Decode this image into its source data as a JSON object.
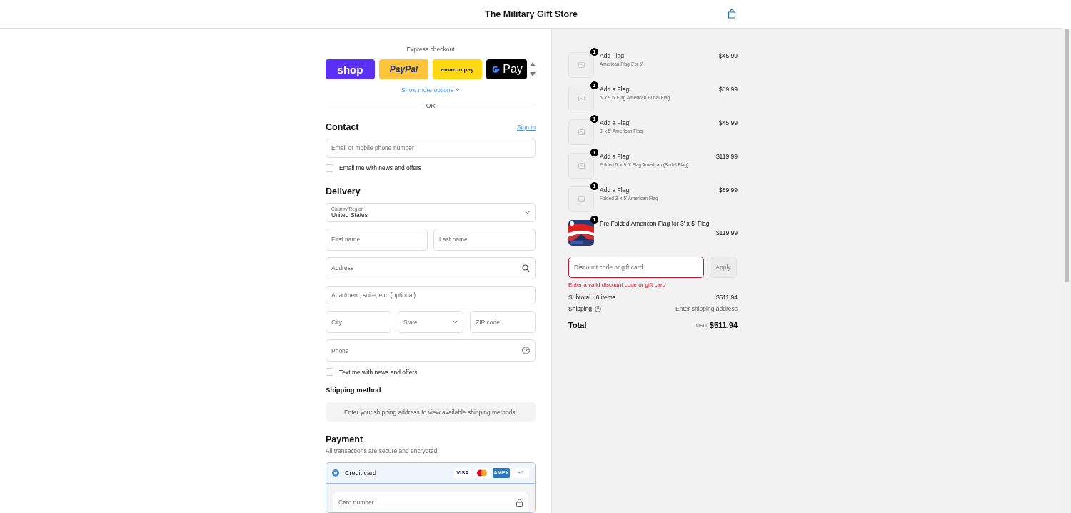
{
  "header": {
    "store_name": "The Military Gift Store"
  },
  "express": {
    "title": "Express checkout",
    "buttons": [
      {
        "kind": "shop",
        "label": "shop"
      },
      {
        "kind": "paypal",
        "label": "PayPal"
      },
      {
        "kind": "amazon",
        "label": "amazon pay"
      },
      {
        "kind": "gpay",
        "label": "Pay"
      }
    ],
    "more": "Show more options",
    "divider": "OR"
  },
  "contact": {
    "title": "Contact",
    "sign_in": "Sign in",
    "email": {
      "placeholder": "Email or mobile phone number"
    },
    "newsletter": {
      "label": "Email me with news and offers",
      "checked": false
    }
  },
  "delivery": {
    "title": "Delivery",
    "country": {
      "label": "Country/Region",
      "value": "United States"
    },
    "first_name": {
      "placeholder": "First name"
    },
    "last_name": {
      "placeholder": "Last name"
    },
    "address": {
      "placeholder": "Address"
    },
    "apartment": {
      "placeholder": "Apartment, suite, etc. (optional)"
    },
    "city": {
      "placeholder": "City"
    },
    "state": {
      "placeholder": "State"
    },
    "zip": {
      "placeholder": "ZIP code"
    },
    "phone": {
      "placeholder": "Phone"
    },
    "sms": {
      "label": "Text me with news and offers",
      "checked": false
    }
  },
  "shipping_method": {
    "title": "Shipping method",
    "message": "Enter your shipping address to view available shipping methods."
  },
  "payment": {
    "title": "Payment",
    "subtitle": "All transactions are secure and encrypted.",
    "methods": [
      {
        "label": "Credit card",
        "selected": true,
        "brands": [
          {
            "kind": "visa",
            "label": "VISA"
          },
          {
            "kind": "mastercard"
          },
          {
            "kind": "amex",
            "label": "AMEX"
          },
          {
            "kind": "more",
            "label": "+5"
          }
        ]
      }
    ],
    "card_number": {
      "placeholder": "Card number"
    }
  },
  "cart": {
    "items": [
      {
        "kind": "placeholder",
        "quantity": "1",
        "title": "Add Flag",
        "variant": "American Flag 3' x 5'",
        "price": "$45.99"
      },
      {
        "kind": "placeholder",
        "quantity": "1",
        "title": "Add a Flag:",
        "variant": "5' x 9.5' Flag American Burial Flag",
        "price": "$89.99"
      },
      {
        "kind": "placeholder",
        "quantity": "1",
        "title": "Add a Flag:",
        "variant": "3' x 5' American Flag",
        "price": "$45.99"
      },
      {
        "kind": "placeholder",
        "quantity": "1",
        "title": "Add a Flag:",
        "variant": "Folded 5' x 9.5' Flag American (Burial Flag)",
        "price": "$119.99"
      },
      {
        "kind": "placeholder",
        "quantity": "1",
        "title": "Add a Flag:",
        "variant": "Folded 3' x 5' American Flag",
        "price": "$89.99"
      },
      {
        "kind": "picture",
        "quantity": "1",
        "title": "Pre Folded American Flag for 3' x 5' Flag",
        "price": "$119.99"
      }
    ],
    "discount": {
      "placeholder": "Discount code or gift card",
      "error": "Enter a valid discount code or gift card",
      "button": "Apply"
    },
    "subtotal": {
      "label": "Subtotal · 6 items",
      "value": "$511.94"
    },
    "shipping": {
      "label": "Shipping",
      "value": "Enter shipping address"
    },
    "total": {
      "label": "Total",
      "currency": "USD",
      "value": "$511.94"
    }
  }
}
